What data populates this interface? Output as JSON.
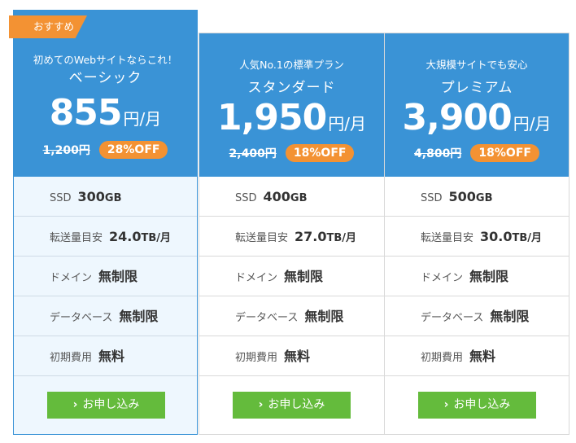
{
  "plans": [
    {
      "ribbon": "おすすめ",
      "tagline": "初めてのWebサイトならこれ！",
      "name": "ベーシック",
      "price": "855",
      "unit": "円/月",
      "old_price": "1,200円",
      "discount": "28%OFF",
      "features": {
        "ssd": {
          "label": "SSD",
          "value": "300",
          "unit": "GB"
        },
        "transfer": {
          "label": "転送量目安",
          "value": "24.0",
          "unit": "TB/月"
        },
        "domain": {
          "label": "ドメイン",
          "value": "無制限"
        },
        "database": {
          "label": "データベース",
          "value": "無制限"
        },
        "initial_fee": {
          "label": "初期費用",
          "value": "無料"
        }
      },
      "button": "お申し込み"
    },
    {
      "tagline": "人気No.1の標準プラン",
      "name": "スタンダード",
      "price": "1,950",
      "unit": "円/月",
      "old_price": "2,400円",
      "discount": "18%OFF",
      "features": {
        "ssd": {
          "label": "SSD",
          "value": "400",
          "unit": "GB"
        },
        "transfer": {
          "label": "転送量目安",
          "value": "27.0",
          "unit": "TB/月"
        },
        "domain": {
          "label": "ドメイン",
          "value": "無制限"
        },
        "database": {
          "label": "データベース",
          "value": "無制限"
        },
        "initial_fee": {
          "label": "初期費用",
          "value": "無料"
        }
      },
      "button": "お申し込み"
    },
    {
      "tagline": "大規模サイトでも安心",
      "name": "プレミアム",
      "price": "3,900",
      "unit": "円/月",
      "old_price": "4,800円",
      "discount": "18%OFF",
      "features": {
        "ssd": {
          "label": "SSD",
          "value": "500",
          "unit": "GB"
        },
        "transfer": {
          "label": "転送量目安",
          "value": "30.0",
          "unit": "TB/月"
        },
        "domain": {
          "label": "ドメイン",
          "value": "無制限"
        },
        "database": {
          "label": "データベース",
          "value": "無制限"
        },
        "initial_fee": {
          "label": "初期費用",
          "value": "無料"
        }
      },
      "button": "お申し込み"
    }
  ],
  "colors": {
    "header": "#3a93d6",
    "accent": "#f39233",
    "button": "#64bb3c",
    "featured_bg": "#eef7fe"
  },
  "icons": {
    "button_chevron": "chevron-right-icon"
  }
}
